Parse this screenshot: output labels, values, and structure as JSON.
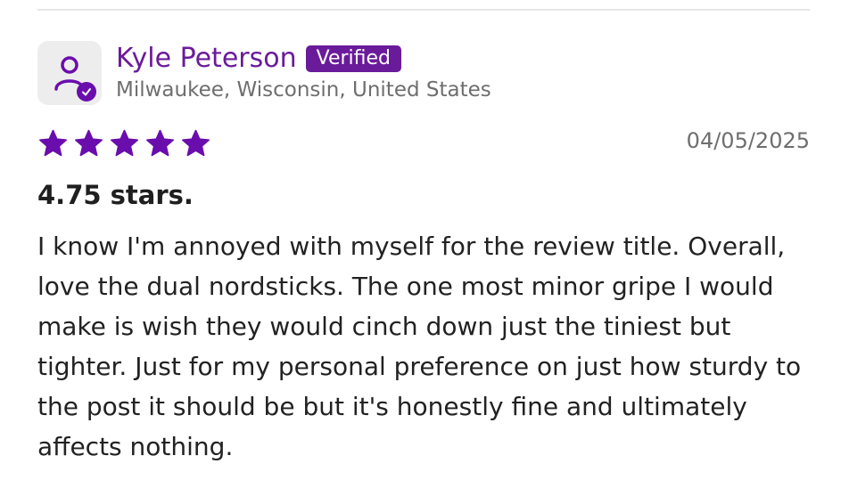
{
  "review": {
    "author_name": "Kyle Peterson",
    "verified_label": "Verified",
    "location": "Milwaukee, Wisconsin, United States",
    "rating": 5,
    "date": "04/05/2025",
    "title": "4.75 stars.",
    "body": "I know I'm annoyed with myself for the review title. Overall, love the dual nordsticks. The one most minor gripe I would make is wish they would cinch down just the tiniest but tighter. Just for my personal preference on just how sturdy to the post it should be but it's honestly fine and ultimately affects nothing."
  },
  "icons": {
    "avatar": "user-icon",
    "verified_check": "check-icon",
    "star": "star-icon"
  },
  "colors": {
    "accent": "#6a1b9a",
    "star": "#6a0dad",
    "muted_text": "#6e6e6e",
    "body_text": "#222222"
  }
}
